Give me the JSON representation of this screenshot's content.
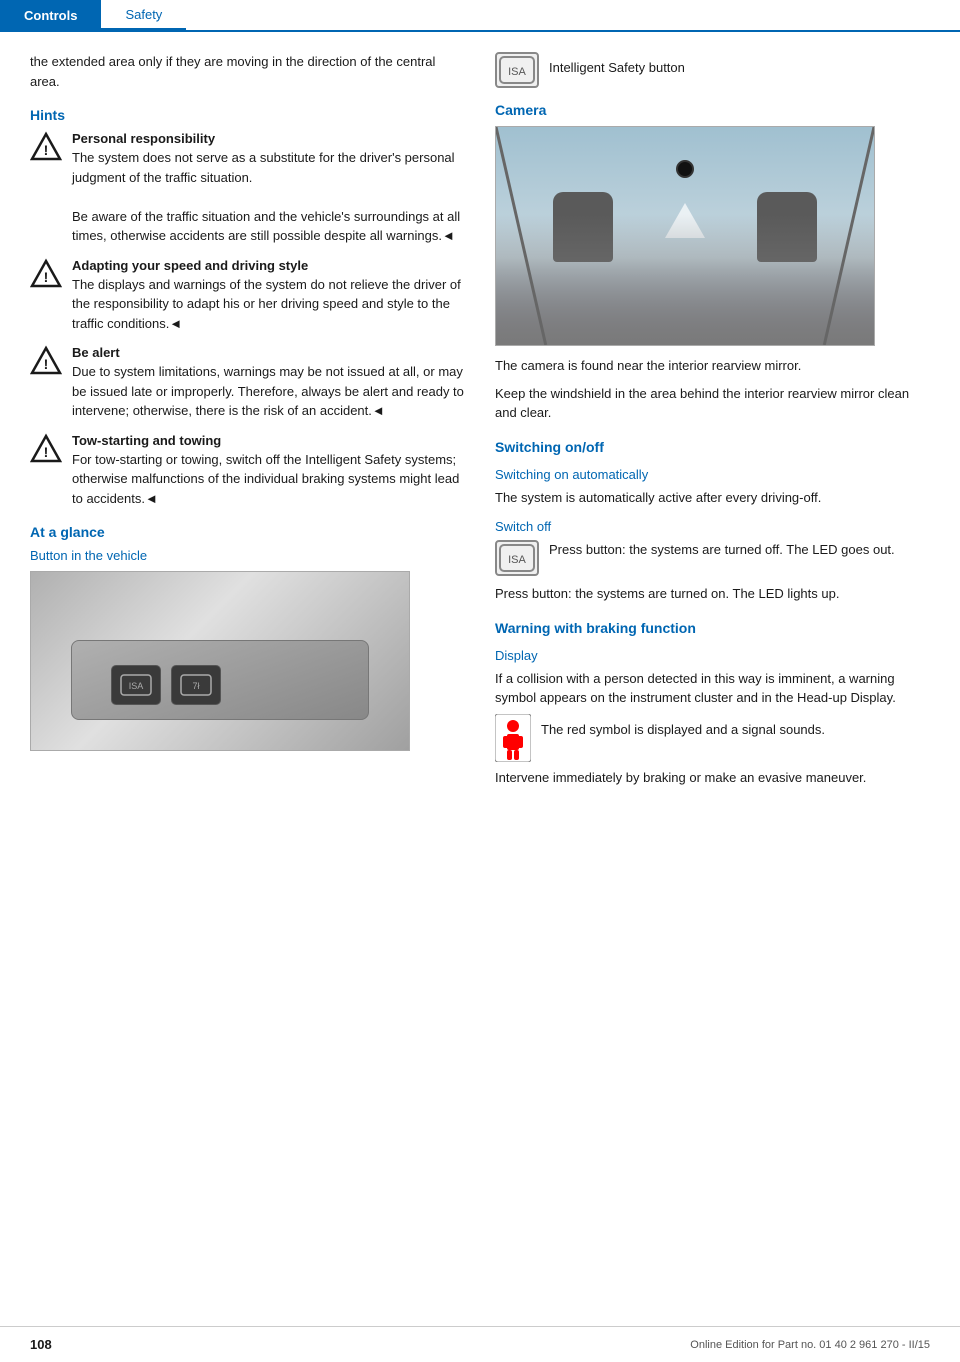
{
  "header": {
    "tab_controls": "Controls",
    "tab_safety": "Safety"
  },
  "left_col": {
    "intro_text": "the extended area only if they are moving in the direction of the central area.",
    "hints_heading": "Hints",
    "warnings": [
      {
        "title": "Personal responsibility",
        "text": "The system does not serve as a substitute for the driver's personal judgment of the traffic situation.\nBe aware of the traffic situation and the vehicle's surroundings at all times, otherwise accidents are still possible despite all warnings.◄"
      },
      {
        "title": "Adapting your speed and driving style",
        "text": "The displays and warnings of the system do not relieve the driver of the responsibility to adapt his or her driving speed and style to the traffic conditions.◄"
      },
      {
        "title": "Be alert",
        "text": "Due to system limitations, warnings may be not issued at all, or may be issued late or improperly. Therefore, always be alert and ready to intervene; otherwise, there is the risk of an accident.◄"
      },
      {
        "title": "Tow-starting and towing",
        "text": "For tow-starting or towing, switch off the Intelligent Safety systems; otherwise malfunctions of the individual braking systems might lead to accidents.◄"
      }
    ],
    "at_a_glance_heading": "At a glance",
    "button_in_vehicle_heading": "Button in the vehicle",
    "button_img_alt": "Vehicle button panel showing Intelligent Safety buttons"
  },
  "right_col": {
    "intelligent_safety_label": "Intelligent Safety button",
    "camera_heading": "Camera",
    "camera_img_alt": "Camera view from interior rearview mirror area",
    "camera_text1": "The camera is found near the interior rearview mirror.",
    "camera_text2": "Keep the windshield in the area behind the interior rearview mirror clean and clear.",
    "switching_heading": "Switching on/off",
    "switching_auto_subheading": "Switching on automatically",
    "switching_auto_text": "The system is automatically active after every driving-off.",
    "switch_off_subheading": "Switch off",
    "switch_off_text1": "Press button: the systems are turned off. The LED goes out.",
    "switch_off_text2": "Press button: the systems are turned on. The LED lights up.",
    "warning_braking_heading": "Warning with braking function",
    "display_subheading": "Display",
    "display_text": "If a collision with a person detected in this way is imminent, a warning symbol appears on the instrument cluster and in the Head-up Display.",
    "red_symbol_text": "The red symbol is displayed and a signal sounds.",
    "intervene_text": "Intervene immediately by braking or make an evasive maneuver."
  },
  "footer": {
    "page_number": "108",
    "footer_text": "Online Edition for Part no. 01 40 2 961 270 - II/15"
  }
}
